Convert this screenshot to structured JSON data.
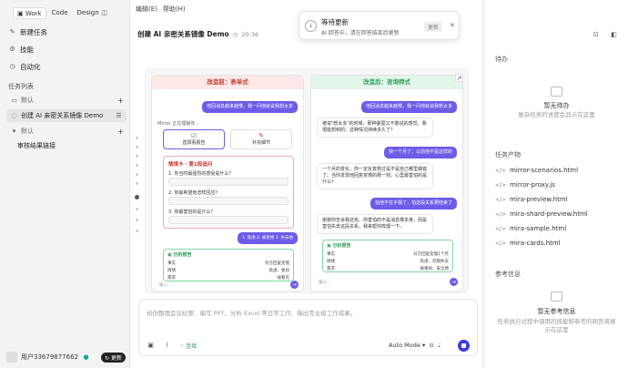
{
  "sidebar": {
    "modes": [
      "Work",
      "Code",
      "Design"
    ],
    "new_task": "新建任务",
    "skills": "技能",
    "automation": "自动化",
    "task_list_header": "任务列表",
    "group1": "默认",
    "task_active": "创建 AI 亲密关系镜像 Demo",
    "group2": "默认",
    "task_other": "审核结果链接",
    "user_name": "用户33679877662",
    "update_label": "更新"
  },
  "menu": {
    "edit": "编辑(E)",
    "help": "帮助(H)"
  },
  "main": {
    "title": "创建 AI 亲密关系镜像 Demo",
    "time": "20:36",
    "left_panel": {
      "head": "改造前：表单式",
      "user_msg": "他回消息越来越慢，我一问他就说我想太多",
      "bot_line": "Mirror 正在理解你...",
      "card_a": "直球看报告",
      "card_b": "补充细节",
      "form_title": "情境卡 · 第1段追问",
      "q1": "1. 你当时最强烈的感受是什么？",
      "q2": "2. 你最希望他怎样回应？",
      "q3": "3. 你最害怕的是什么？",
      "chip": "1. 焦虑 2. 被拒绝 3. 失去他",
      "report_title": "分析报告",
      "report_rows": [
        [
          "事实",
          "对方回复变慢"
        ],
        [
          "情绪",
          "焦虑、委屈"
        ],
        [
          "需求",
          "被看见"
        ]
      ],
      "input_ph": "输入..."
    },
    "right_panel": {
      "head": "改造后：咨询师式",
      "user_msg": "他回消息越来越慢，我一问他就说我想太多",
      "bot1": "被说\"想太多\"的时候，那种委屈又不敢说的感觉，我很能想到的。这种情况持续多久了？",
      "user2": "快一个月了，以前他不是这样的",
      "bot2": "一个月的变化，你一定反复想过是不是自己哪里做错了。当你发现他回复变慢的那一刻，心里最害怕的是什么？",
      "user3": "怕他不在乎我了，怕这段关系要结束了",
      "bot3": "谢谢你告诉我这些。你害怕的不是消息慢本身，而是害怕失去这段关系。我来帮你梳理一下。",
      "report_title": "分析报告",
      "report_rows": [
        [
          "事实",
          "对方回复变慢1个月"
        ],
        [
          "情绪",
          "焦虑、恐惧失去"
        ],
        [
          "需求",
          "被重视、安全感"
        ]
      ],
      "input_ph": "输入..."
    },
    "input": {
      "placeholder": "给你整理会议纪要、编写 PPT、分析 Excel 等日常工作、输出专业级工作成果。",
      "connect": "连接",
      "mode": "Auto Mode"
    }
  },
  "right": {
    "todo_title": "待办",
    "todo_empty": "暂无待办",
    "todo_sub": "复杂任务的进度会显示在这里",
    "output_title": "任务产物",
    "files": [
      "mirror-scenarios.html",
      "mirror-proxy.js",
      "mira-preview.html",
      "mira-shard-preview.html",
      "mira-sample.html",
      "mira-cards.html"
    ],
    "ref_title": "参考信息",
    "ref_empty": "暂无参考信息",
    "ref_sub": "任务执行过程中调用的技能和参考的网页将展示在这里"
  },
  "toast": {
    "title": "等待更新",
    "sub": "AI 回答中，请在回答结束后更新",
    "button": "更新"
  }
}
